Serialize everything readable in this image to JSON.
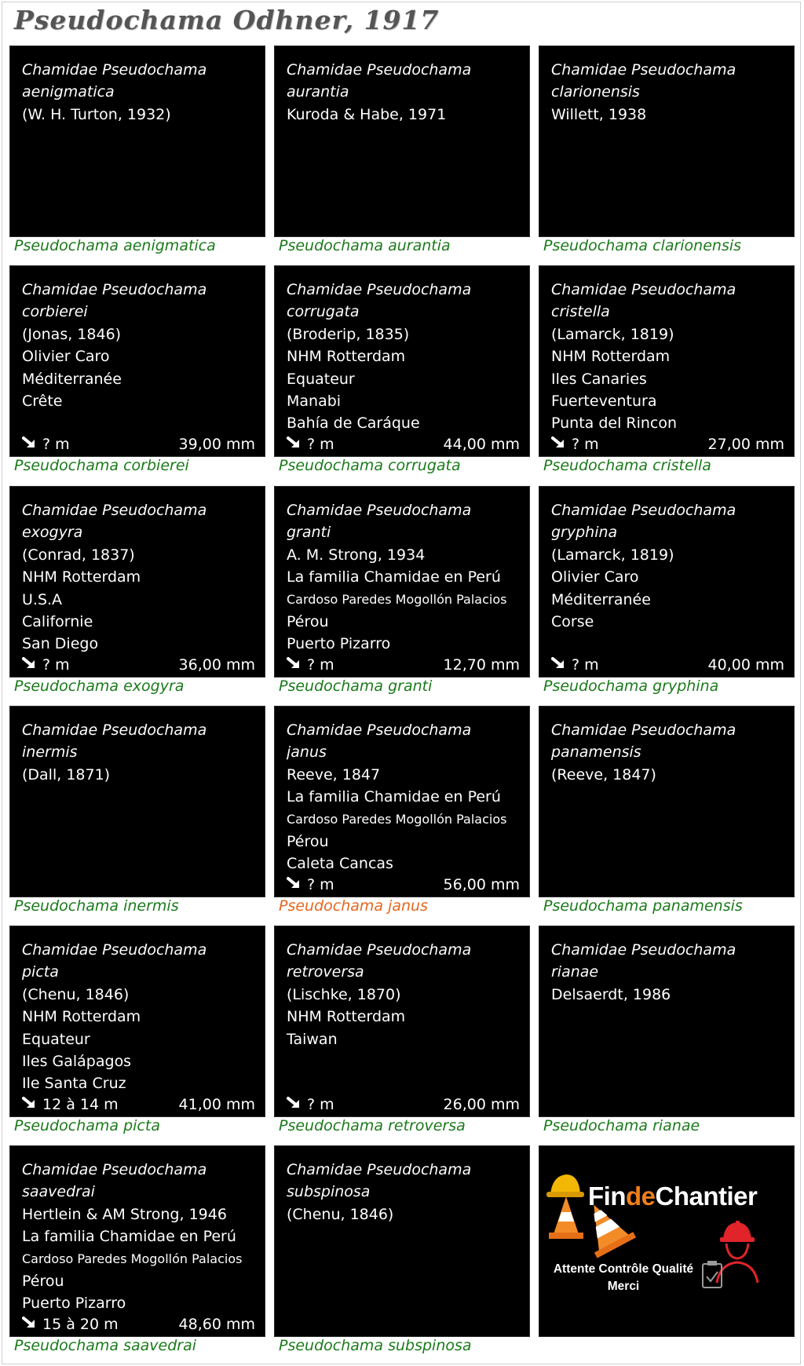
{
  "page": {
    "title": "Pseudochama Odhner, 1917"
  },
  "cards": [
    {
      "family": "Chamidae Pseudochama",
      "species": "aenigmatica",
      "lines": [
        "(W. H. Turton, 1932)"
      ],
      "caption": "Pseudochama aenigmatica"
    },
    {
      "family": "Chamidae Pseudochama",
      "species": "aurantia",
      "lines": [
        "Kuroda & Habe, 1971"
      ],
      "caption": "Pseudochama aurantia"
    },
    {
      "family": "Chamidae Pseudochama",
      "species": "clarionensis",
      "lines": [
        "Willett, 1938"
      ],
      "caption": "Pseudochama clarionensis"
    },
    {
      "family": "Chamidae Pseudochama",
      "species": "corbierei",
      "lines": [
        "(Jonas, 1846)",
        "Olivier Caro",
        "Méditerranée",
        "Crête"
      ],
      "depth": "? m",
      "size": "39,00 mm",
      "caption": "Pseudochama corbierei"
    },
    {
      "family": "Chamidae Pseudochama",
      "species": "corrugata",
      "lines": [
        "(Broderip, 1835)",
        "NHM Rotterdam",
        "Equateur",
        "Manabi",
        "Bahía de Caráque"
      ],
      "depth": "? m",
      "size": "44,00 mm",
      "caption": "Pseudochama corrugata"
    },
    {
      "family": "Chamidae Pseudochama",
      "species": "cristella",
      "lines": [
        "(Lamarck, 1819)",
        "NHM Rotterdam",
        "Iles Canaries",
        "Fuerteventura",
        "Punta del Rincon"
      ],
      "depth": "? m",
      "size": "27,00 mm",
      "caption": "Pseudochama cristella"
    },
    {
      "family": "Chamidae Pseudochama",
      "species": "exogyra",
      "lines": [
        "(Conrad, 1837)",
        "NHM Rotterdam",
        "U.S.A",
        "Californie",
        "San Diego"
      ],
      "depth": "? m",
      "size": "36,00 mm",
      "caption": "Pseudochama exogyra"
    },
    {
      "family": "Chamidae Pseudochama",
      "species": "granti",
      "lines": [
        "A. M. Strong, 1934",
        "La familia Chamidae en Perú",
        "Cardoso Paredes Mogollón Palacios",
        "Pérou",
        "Puerto Pizarro"
      ],
      "depth": "? m",
      "size": "12,70 mm",
      "caption": "Pseudochama granti"
    },
    {
      "family": "Chamidae Pseudochama",
      "species": "gryphina",
      "lines": [
        "(Lamarck, 1819)",
        "Olivier Caro",
        "Méditerranée",
        "Corse"
      ],
      "depth": "? m",
      "size": "40,00 mm",
      "caption": "Pseudochama gryphina"
    },
    {
      "family": "Chamidae Pseudochama",
      "species": "inermis",
      "lines": [
        "(Dall, 1871)"
      ],
      "caption": "Pseudochama inermis"
    },
    {
      "family": "Chamidae Pseudochama",
      "species": "janus",
      "lines": [
        "Reeve, 1847",
        "La familia Chamidae en Perú",
        "Cardoso Paredes Mogollón Palacios",
        "Pérou",
        "Caleta Cancas"
      ],
      "depth": "? m",
      "size": "56,00 mm",
      "caption": "Pseudochama janus"
    },
    {
      "family": "Chamidae Pseudochama",
      "species": "panamensis",
      "lines": [
        "(Reeve, 1847)"
      ],
      "caption": "Pseudochama panamensis"
    },
    {
      "family": "Chamidae Pseudochama",
      "species": "picta",
      "lines": [
        "(Chenu, 1846)",
        "NHM Rotterdam",
        "Equateur",
        "Iles Galápagos",
        "Ile Santa Cruz"
      ],
      "depth": "12 à 14 m",
      "size": "41,00 mm",
      "caption": "Pseudochama picta"
    },
    {
      "family": "Chamidae Pseudochama",
      "species": "retroversa",
      "lines": [
        "(Lischke, 1870)",
        "NHM Rotterdam",
        "Taiwan"
      ],
      "depth": "? m",
      "size": "26,00 mm",
      "caption": "Pseudochama retroversa"
    },
    {
      "family": "Chamidae Pseudochama",
      "species": "rianae",
      "lines": [
        "Delsaerdt, 1986"
      ],
      "caption": "Pseudochama rianae"
    },
    {
      "family": "Chamidae Pseudochama",
      "species": "saavedrai",
      "lines": [
        "Hertlein & AM Strong, 1946",
        "La familia Chamidae en Perú",
        "Cardoso Paredes Mogollón Palacios",
        "Pérou",
        "Puerto Pizarro"
      ],
      "depth": "15 à 20 m",
      "size": "48,60 mm",
      "caption": "Pseudochama saavedrai"
    },
    {
      "family": "Chamidae Pseudochama",
      "species": "subspinosa",
      "lines": [
        "(Chenu, 1846)"
      ],
      "caption": "Pseudochama subspinosa"
    }
  ],
  "placeholder": {
    "brand_start": "Fin",
    "brand_mid": "de",
    "brand_end": "Chantier",
    "status_line1": "Attente Contrôle Qualité",
    "status_line2": "Merci"
  },
  "colors": {
    "caption_default": "#1a7a1a",
    "caption_highlight": "#e6661e",
    "card_background": "#000000",
    "brand_orange": "#ef7f1a",
    "brand_red": "#e0242a"
  },
  "icons": {
    "depth": "down-right-arrow-icon"
  }
}
